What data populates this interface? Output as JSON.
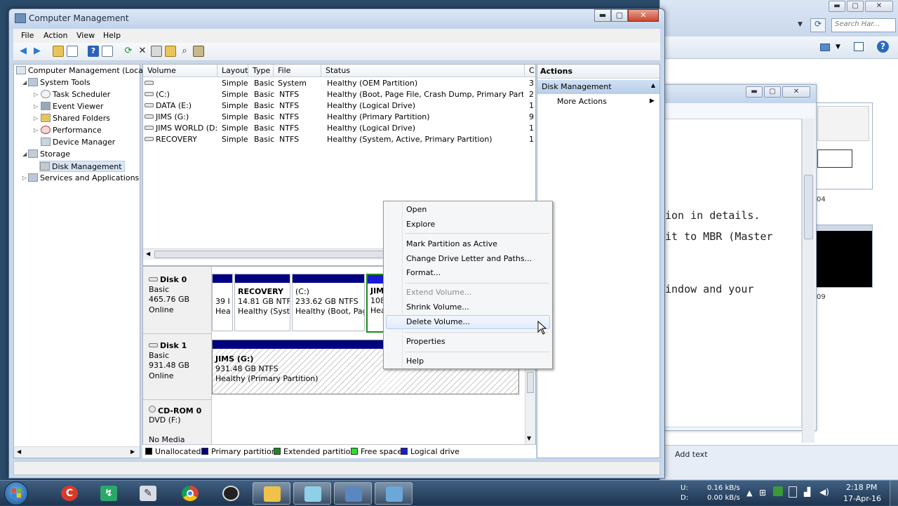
{
  "window": {
    "title": "Computer Management",
    "min": "▬",
    "max": "▢",
    "close": "✕"
  },
  "menu": [
    "File",
    "Action",
    "View",
    "Help"
  ],
  "toolbar_icons": [
    "back-arrow-icon",
    "forward-arrow-icon",
    "up-folder-icon",
    "show-hide-tree-icon",
    "help-icon",
    "show-pane-icon",
    "refresh-icon",
    "delete-icon",
    "properties-icon",
    "open-folder-icon",
    "search-icon",
    "export-icon"
  ],
  "tree": {
    "root": "Computer Management (Local",
    "system_tools": "System Tools",
    "task_scheduler": "Task Scheduler",
    "event_viewer": "Event Viewer",
    "shared_folders": "Shared Folders",
    "performance": "Performance",
    "device_manager": "Device Manager",
    "storage": "Storage",
    "disk_management": "Disk Management",
    "services": "Services and Applications"
  },
  "volumes": {
    "headers": [
      "Volume",
      "Layout",
      "Type",
      "File System",
      "Status",
      "C"
    ],
    "rows": [
      [
        "",
        "Simple",
        "Basic",
        "",
        "Healthy (OEM Partition)",
        "3"
      ],
      [
        "(C:)",
        "Simple",
        "Basic",
        "NTFS",
        "Healthy (Boot, Page File, Crash Dump, Primary Partition)",
        "2"
      ],
      [
        "DATA (E:)",
        "Simple",
        "Basic",
        "NTFS",
        "Healthy (Logical Drive)",
        "1"
      ],
      [
        "JIMS (G:)",
        "Simple",
        "Basic",
        "NTFS",
        "Healthy (Primary Partition)",
        "9"
      ],
      [
        "JIMS WORLD (D:)",
        "Simple",
        "Basic",
        "NTFS",
        "Healthy (Logical Drive)",
        "1"
      ],
      [
        "RECOVERY",
        "Simple",
        "Basic",
        "NTFS",
        "Healthy (System, Active, Primary Partition)",
        "1"
      ]
    ]
  },
  "disks": {
    "disk0": {
      "name": "Disk 0",
      "type": "Basic",
      "size": "465.76 GB",
      "status": "Online",
      "p1": {
        "l1": "39 I",
        "l2": "Hea"
      },
      "p2": {
        "name": "RECOVERY",
        "size": "14.81 GB NTF",
        "status": "Healthy (Syst"
      },
      "p3": {
        "name": "(C:)",
        "size": "233.62 GB NTFS",
        "status": "Healthy (Boot, Pag"
      },
      "p4": {
        "name": "JIM",
        "size": "108",
        "status": "Hea"
      }
    },
    "disk1": {
      "name": "Disk 1",
      "type": "Basic",
      "size": "931.48 GB",
      "status": "Online",
      "p1": {
        "name": "JIMS  (G:)",
        "size": "931.48 GB NTFS",
        "status": "Healthy (Primary Partition)"
      }
    },
    "cdrom0": {
      "name": "CD-ROM 0",
      "type": "DVD (F:)",
      "status": "No Media"
    }
  },
  "legend": [
    {
      "label": "Unallocated",
      "color": "#000000"
    },
    {
      "label": "Primary partition",
      "color": "#000080"
    },
    {
      "label": "Extended partition",
      "color": "#1f8a1f"
    },
    {
      "label": "Free space",
      "color": "#28e028"
    },
    {
      "label": "Logical drive",
      "color": "#1a1ad6"
    }
  ],
  "actions": {
    "header": "Actions",
    "selected": "Disk Management",
    "more": "More Actions"
  },
  "context_menu": {
    "open": "Open",
    "explore": "Explore",
    "mark_active": "Mark Partition as Active",
    "change_letter": "Change Drive Letter and Paths...",
    "format": "Format...",
    "extend": "Extend Volume...",
    "shrink": "Shrink Volume...",
    "delete": "Delete Volume...",
    "properties": "Properties",
    "help": "Help"
  },
  "background": {
    "search_placeholder": "Search Har...",
    "editor_lines": [
      "ion in details.",
      "it to MBR (Master",
      "indow and your"
    ],
    "thumb1_caption": "04",
    "thumb2_caption": "09",
    "add_text": "Add text"
  },
  "taskbar": {
    "net_u_label": "U:",
    "net_d_label": "D:",
    "net_u": "0.16 kB/s",
    "net_d": "0.00 kB/s",
    "time": "2:18 PM",
    "date": "17-Apr-16"
  }
}
